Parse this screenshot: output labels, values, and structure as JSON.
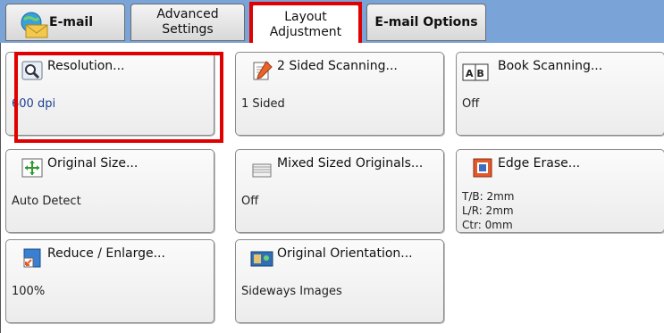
{
  "tabs": {
    "email": "E-mail",
    "advanced_line1": "Advanced",
    "advanced_line2": "Settings",
    "layout_line1": "Layout",
    "layout_line2": "Adjustment",
    "email_options": "E-mail Options"
  },
  "buttons": {
    "resolution": {
      "title": "Resolution...",
      "value": "600 dpi"
    },
    "two_sided": {
      "title": "2 Sided Scanning...",
      "value": "1 Sided"
    },
    "book_scanning": {
      "title": "Book Scanning...",
      "value": "Off",
      "icon_text": "A B"
    },
    "original_size": {
      "title": "Original Size...",
      "value": "Auto Detect"
    },
    "mixed_sized": {
      "title": "Mixed Sized Originals...",
      "value": "Off"
    },
    "edge_erase": {
      "title": "Edge Erase...",
      "value_tb": "T/B: 2mm",
      "value_lr": "L/R: 2mm",
      "value_ctr": "Ctr: 0mm"
    },
    "reduce_enlarge": {
      "title": "Reduce / Enlarge...",
      "value": "100%"
    },
    "original_orientation": {
      "title": "Original Orientation...",
      "value": "Sideways Images"
    }
  },
  "colors": {
    "tab_bar": "#7aa3d8",
    "highlight": "#e10000",
    "value_blue": "#1c3f94"
  },
  "icons": {
    "email": "email-globe-envelope-icon",
    "resolution": "magnifier-resolution-icon",
    "two_sided": "two-sided-page-icon",
    "book": "open-book-icon",
    "original_size": "size-arrows-icon",
    "mixed_sized": "stacked-pages-icon",
    "edge_erase": "edge-erase-icon",
    "reduce_enlarge": "reduce-enlarge-icon",
    "orientation": "landscape-image-icon"
  }
}
